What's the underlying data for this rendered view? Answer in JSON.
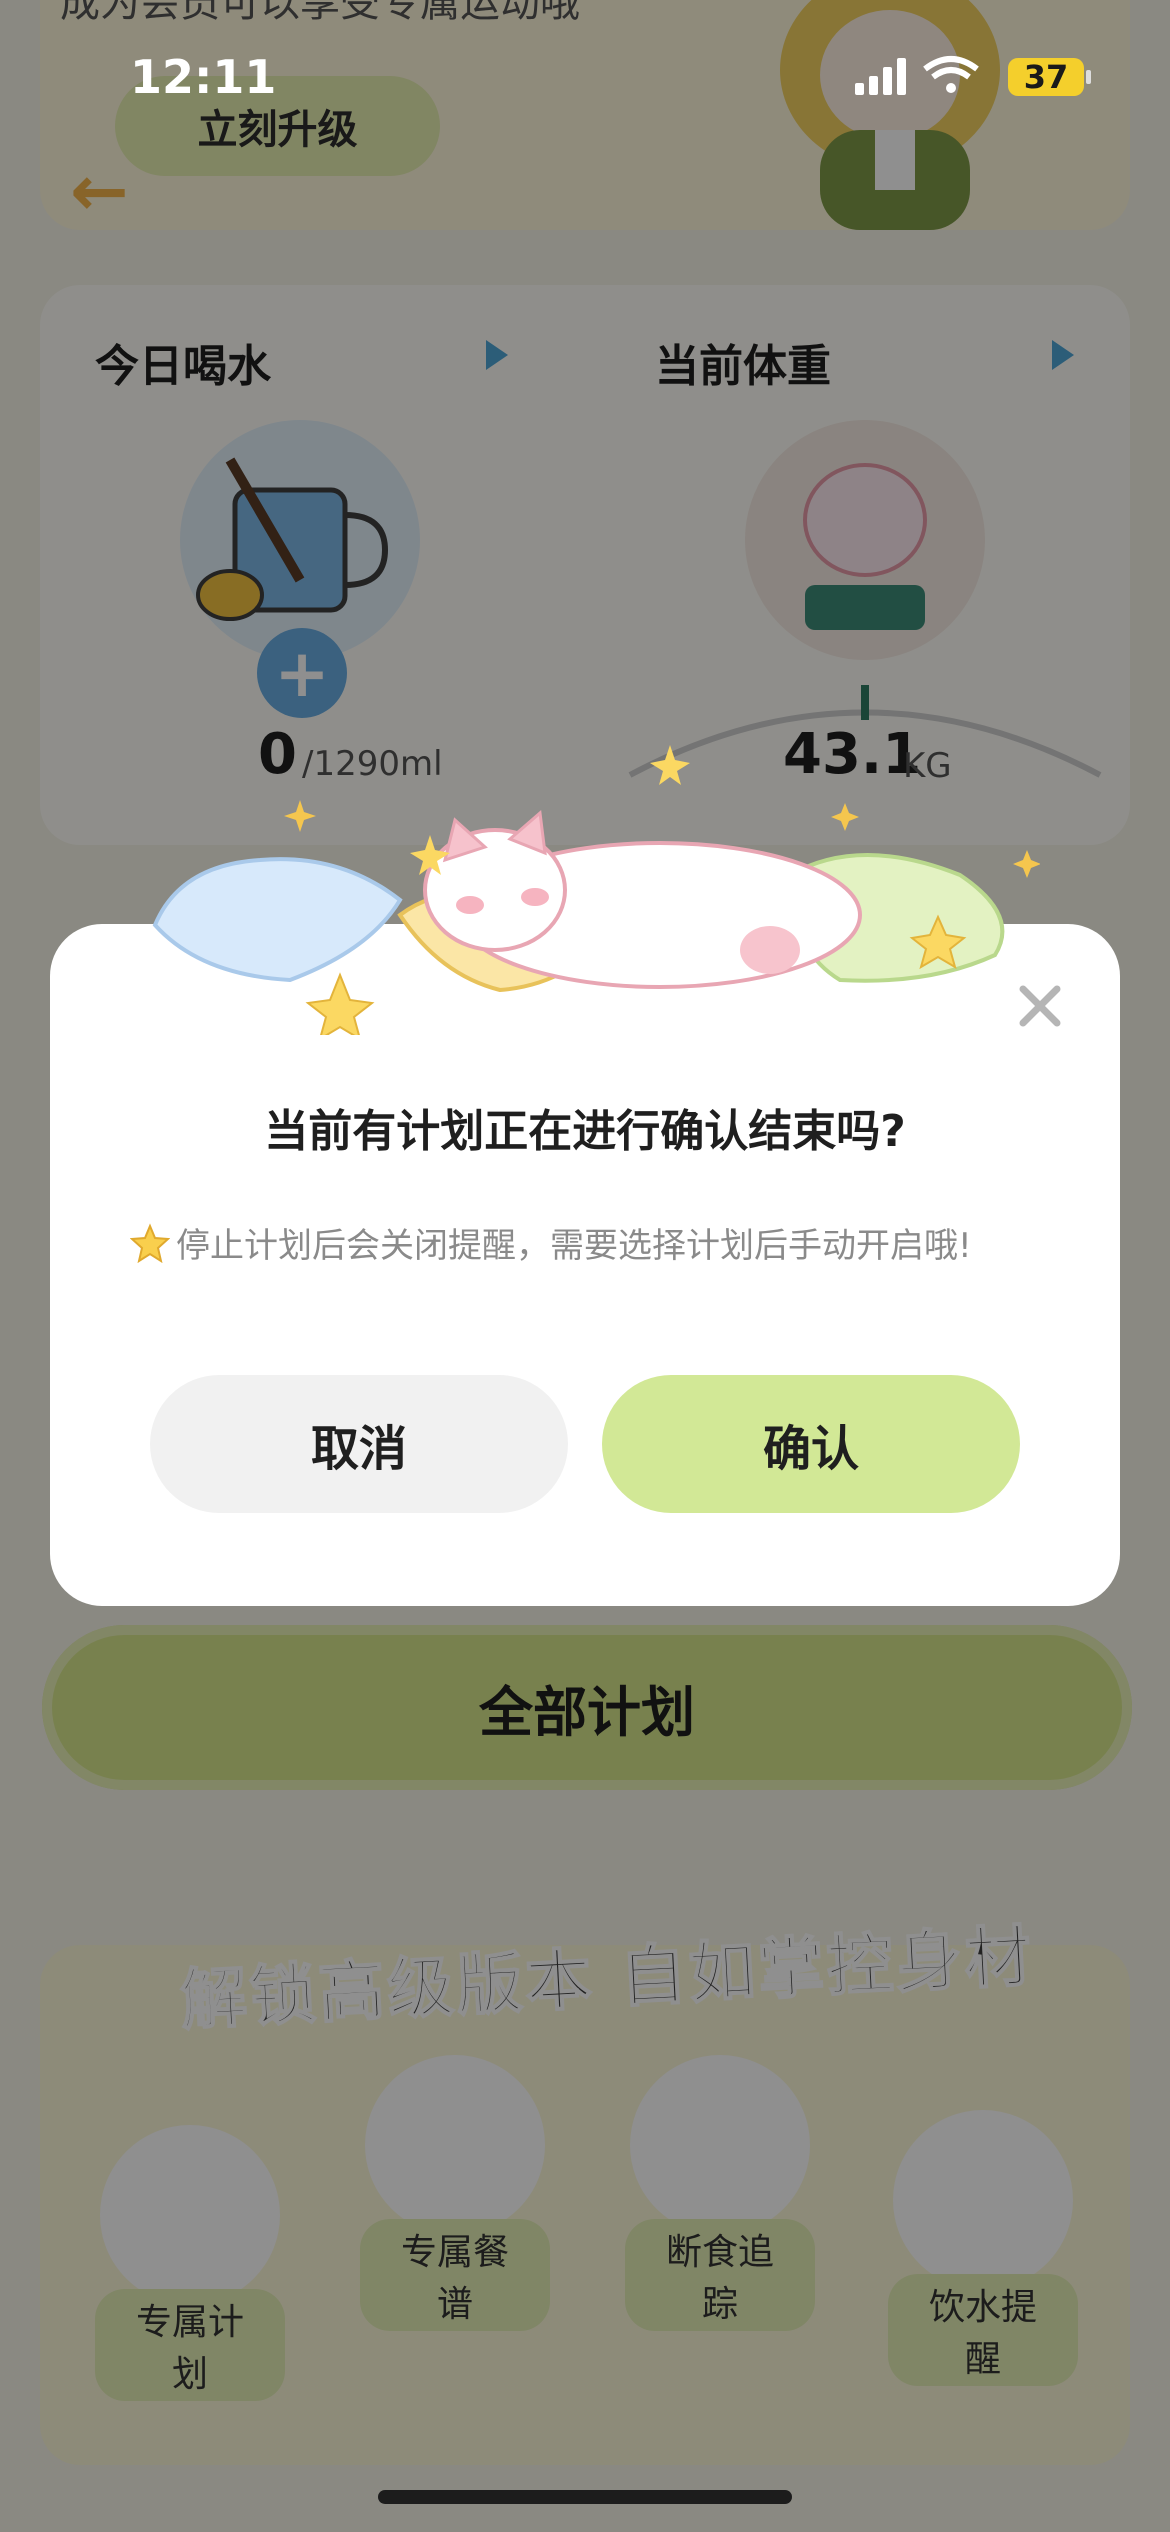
{
  "status_bar": {
    "time": "12:11",
    "battery": "37"
  },
  "background": {
    "hero": {
      "subtitle": "成为会员可以享受专属运动哦",
      "upgrade_label": "立刻升级"
    },
    "water": {
      "title": "今日喝水",
      "value": "0",
      "unit": "/1290ml"
    },
    "weight": {
      "title": "当前体重",
      "value": "43.1",
      "unit": "KG"
    },
    "all_plans_label": "全部计划",
    "promo": {
      "title": "解锁高级版本 自如掌控身材",
      "features": [
        {
          "label": "专属计划",
          "icon": "cat-plan-icon"
        },
        {
          "label": "专属餐谱",
          "icon": "recipe-icon"
        },
        {
          "label": "断食追踪",
          "icon": "fasting-clock-icon"
        },
        {
          "label": "饮水提醒",
          "icon": "water-bell-icon"
        }
      ]
    }
  },
  "modal": {
    "title": "当前有计划正在进行确认结束吗?",
    "note": "停止计划后会关闭提醒，需要选择计划后手动开启哦!",
    "cancel_label": "取消",
    "confirm_label": "确认"
  }
}
